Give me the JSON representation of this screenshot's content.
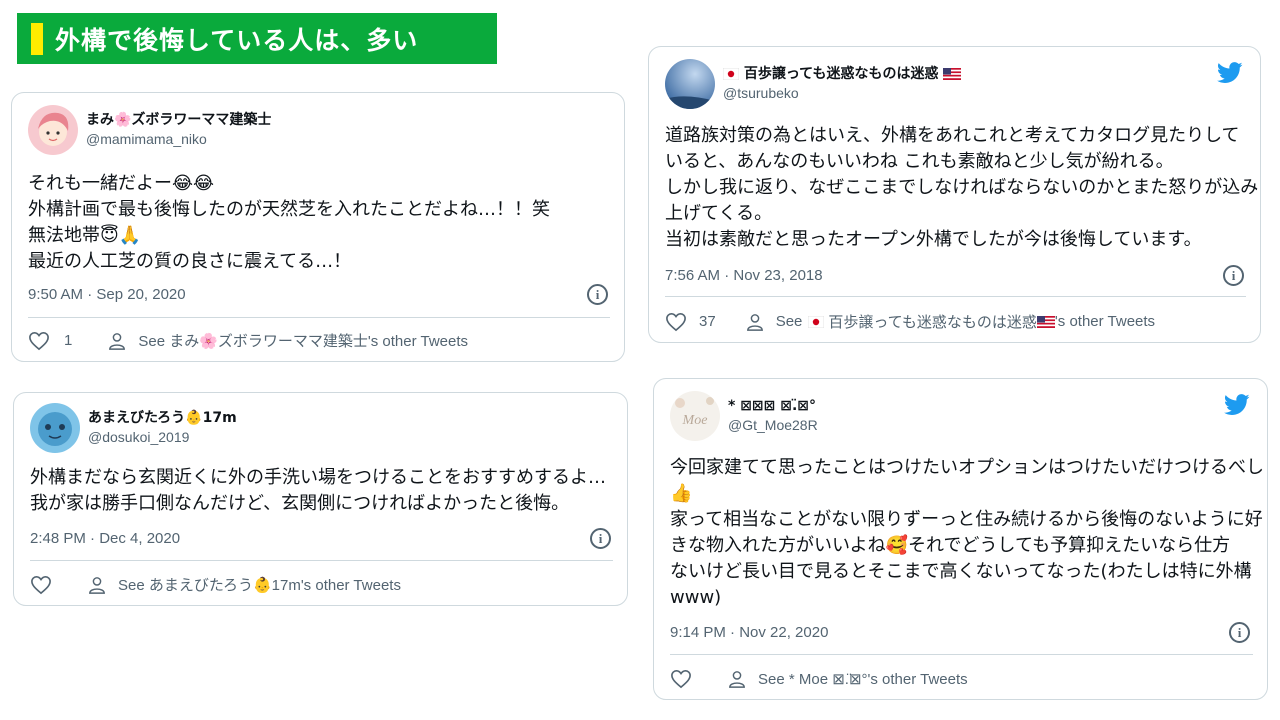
{
  "banner": {
    "title": "外構で後悔している人は、多い"
  },
  "tweets": [
    {
      "display_name": "まみ🌸ズボラワーママ建築士",
      "handle": "@mamimama_niko",
      "lines": [
        "それも一緒だよー😂😂",
        "外構計画で最も後悔したのが天然芝を入れたことだよね…！！笑",
        "無法地帯😇🙏",
        "最近の人工芝の質の良さに震えてる…！"
      ],
      "timestamp": "9:50 AM · Sep 20, 2020",
      "like_count": "1",
      "see_other": "See まみ🌸ズボラワーママ建築士's other Tweets"
    },
    {
      "display_name": "あまえびたろう👶17m",
      "handle": "@dosukoi_2019",
      "lines": [
        "外構まだなら玄関近くに外の手洗い場をつけることをおすすめするよ…",
        "我が家は勝手口側なんだけど、玄関側につければよかったと後悔。"
      ],
      "timestamp": "2:48 PM · Dec 4, 2020",
      "like_count": "",
      "see_other": "See あまえびたろう👶17m's other Tweets"
    },
    {
      "display_name_prefix": "百歩譲っても迷惑なものは迷惑",
      "handle": "@tsurubeko",
      "lines": [
        "道路族対策の為とはいえ、外構をあれこれと考えてカタログ見たりして",
        "いると、あんなのもいいわね これも素敵ねと少し気が紛れる。",
        "しかし我に返り、なぜここまでしなければならないのかとまた怒りが込み",
        "上げてくる。",
        "当初は素敵だと思ったオープン外構でしたが今は後悔しています。"
      ],
      "timestamp": "7:56 AM · Nov 23, 2018",
      "like_count": "37",
      "see_prefix": "See",
      "see_name": "百歩譲っても迷惑なものは迷惑",
      "see_suffix": "'s other Tweets"
    },
    {
      "display_name": "* ⊠⊠⊠ ⊠.̈⊠°",
      "handle": "@Gt_Moe28R",
      "lines": [
        "今回家建てて思ったことはつけたいオプションはつけたいだけつけるべし",
        "👍",
        "家って相当なことがない限りずーっと住み続けるから後悔のないように好",
        "きな物入れた方がいいよね🥰それでどうしても予算抑えたいなら仕方",
        "ないけど長い目で見るとそこまで高くないってなった(わたしは特に外構",
        "www)"
      ],
      "timestamp": "9:14 PM · Nov 22, 2020",
      "like_count": "",
      "see_other": "See * Moe ⊠.̈⊠°'s other Tweets",
      "avatar_text": "Moe"
    }
  ],
  "colors": {
    "banner": "#0aaa3c",
    "banner_mark": "#ffec00",
    "twitter_blue": "#1d9bf0",
    "muted": "#536471"
  }
}
